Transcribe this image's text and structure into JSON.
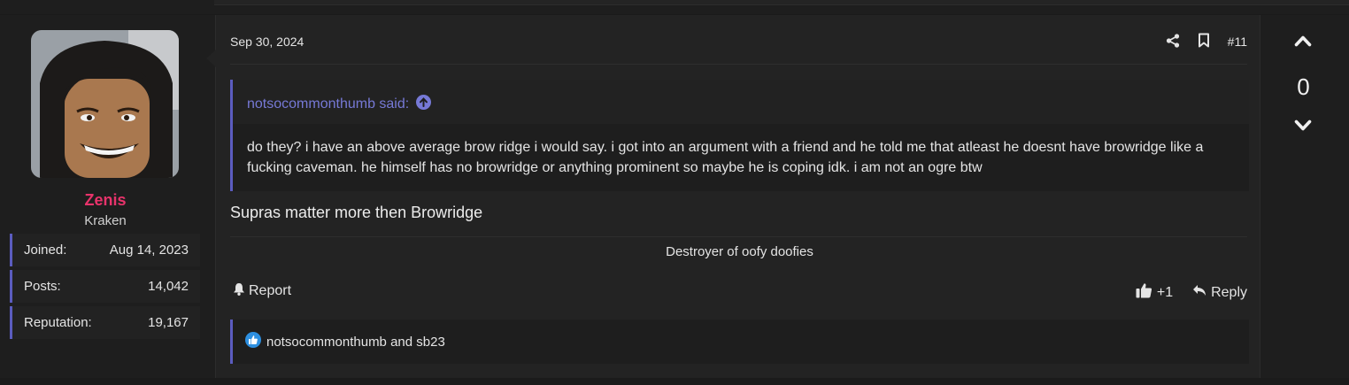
{
  "user": {
    "name": "Zenis",
    "title": "Kraken",
    "stats": [
      {
        "label": "Joined:",
        "value": "Aug 14, 2023"
      },
      {
        "label": "Posts:",
        "value": "14,042"
      },
      {
        "label": "Reputation:",
        "value": "19,167"
      }
    ]
  },
  "post": {
    "date": "Sep 30, 2024",
    "number": "#11",
    "quote": {
      "author": "notsocommonthumb said:",
      "text": "do they? i have an above average brow ridge i would say. i got into an argument with a friend and he told me that atleast he doesnt have browridge like a fucking caveman. he himself has no browridge or anything prominent so maybe he is coping idk. i am not an ogre btw"
    },
    "message": "Supras matter more then Browridge",
    "signature": "Destroyer of oofy doofies",
    "report_label": "Report",
    "like_label": "+1",
    "reply_label": "Reply",
    "likes_text": "notsocommonthumb and sb23"
  },
  "vote": {
    "count": "0"
  },
  "colors": {
    "accent": "#5b5cbf",
    "username": "#e8336b",
    "quote_author": "#7679d6",
    "like_badge": "#2d8fe0"
  }
}
